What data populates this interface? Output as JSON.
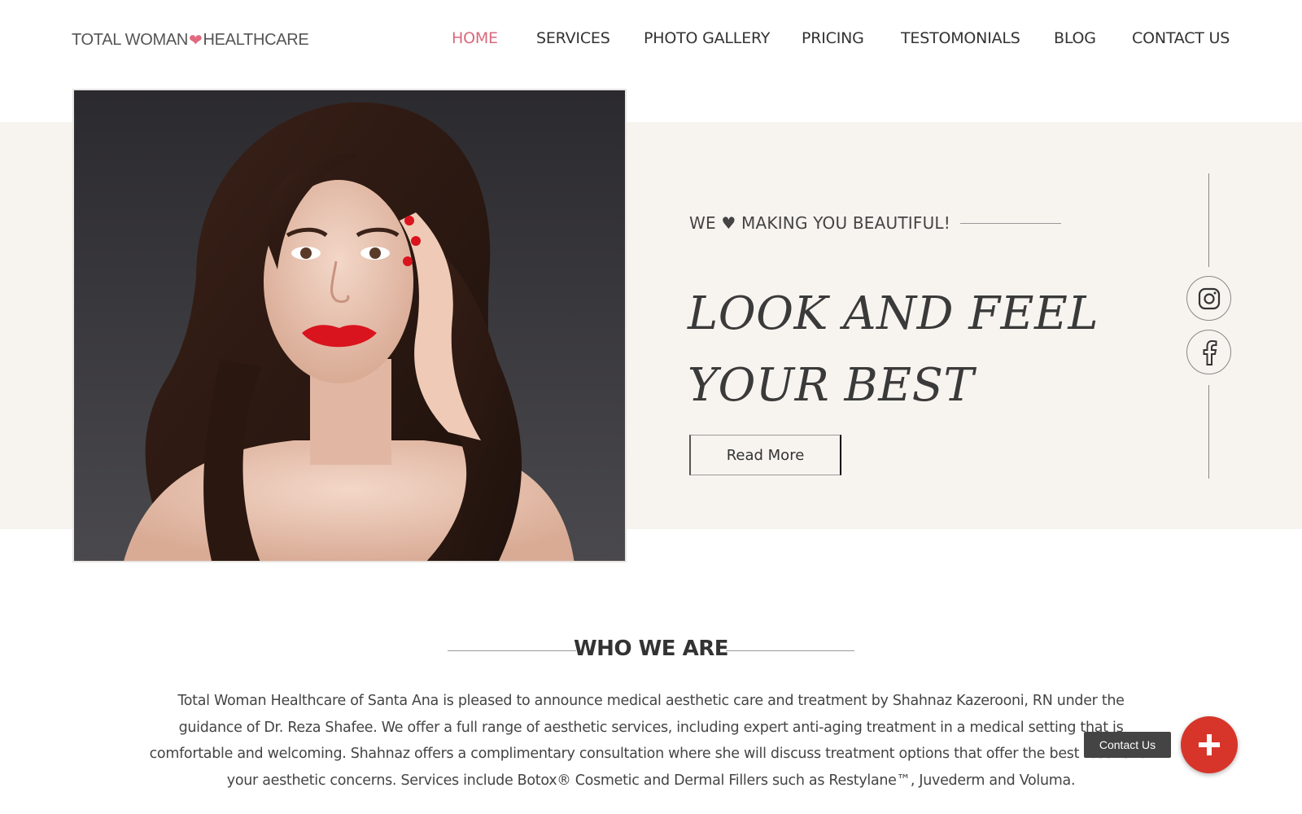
{
  "brand": {
    "logo_left": "TOTAL WOMAN",
    "logo_right": "HEALTHCARE",
    "accent_color": "#d8697c",
    "heart_color": "#e06a80"
  },
  "nav": {
    "items": [
      {
        "label": "HOME",
        "active": true
      },
      {
        "label": "SERVICES",
        "active": false
      },
      {
        "label": "PHOTO GALLERY",
        "active": false
      },
      {
        "label": "PRICING",
        "active": false
      },
      {
        "label": "TESTOMONIALS",
        "active": false
      },
      {
        "label": "BLOG",
        "active": false
      },
      {
        "label": "CONTACT US",
        "active": false
      }
    ]
  },
  "hero": {
    "tagline": "WE ♥ MAKING YOU BEAUTIFUL!",
    "headline_line1": "LOOK AND FEEL",
    "headline_line2": "YOUR BEST",
    "cta_label": "Read More",
    "band_color": "#f7f4f0"
  },
  "social": {
    "icons": [
      "instagram-icon",
      "facebook-icon"
    ]
  },
  "about": {
    "title": "WHO WE ARE",
    "body": "Total Woman Healthcare of Santa Ana is pleased to announce medical aesthetic care and treatment by Shahnaz Kazerooni, RN under the guidance of Dr. Reza Shafee. We offer a full range of aesthetic services, including expert anti-aging treatment in a medical setting that is comfortable and welcoming. Shahnaz offers a complimentary consultation where she will discuss treatment options that offer the best results for your aesthetic concerns. Services include Botox® Cosmetic and Dermal Fillers such as Restylane™, Juvederm and Voluma."
  },
  "floating_contact": {
    "label": "Contact Us",
    "button_color": "#d7352a"
  }
}
